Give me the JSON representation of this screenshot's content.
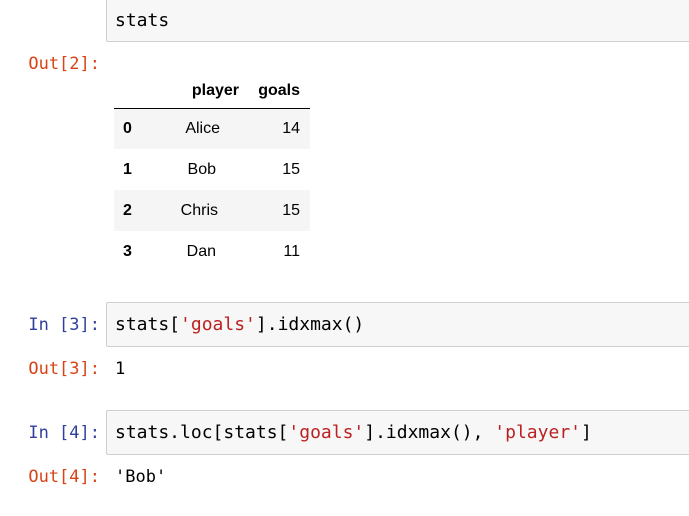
{
  "cells": [
    {
      "out_prompt": "Out[2]:",
      "input_code": "stats"
    },
    {
      "in_prompt": "In [3]:",
      "code": {
        "pre": "stats[",
        "str1": "'goals'",
        "post": "].idxmax()"
      },
      "out_prompt": "Out[3]:",
      "output": "1"
    },
    {
      "in_prompt": "In [4]:",
      "code": {
        "pre": "stats.loc[stats[",
        "str1": "'goals'",
        "mid": "].idxmax(), ",
        "str2": "'player'",
        "post": "]"
      },
      "out_prompt": "Out[4]:",
      "output": "'Bob'"
    }
  ],
  "dataframe": {
    "columns": [
      "player",
      "goals"
    ],
    "rows": [
      {
        "index": "0",
        "player": "Alice",
        "goals": "14"
      },
      {
        "index": "1",
        "player": "Bob",
        "goals": "15"
      },
      {
        "index": "2",
        "player": "Chris",
        "goals": "15"
      },
      {
        "index": "3",
        "player": "Dan",
        "goals": "11"
      }
    ]
  },
  "colors": {
    "in_prompt": "#303f9f",
    "out_prompt": "#d84315",
    "string_token": "#ba2121",
    "input_bg": "#f7f7f7",
    "input_border": "#cfcfcf"
  }
}
